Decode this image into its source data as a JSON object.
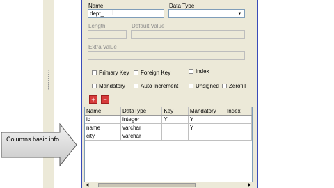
{
  "form": {
    "name_label": "Name",
    "name_value": "dept_",
    "datatype_label": "Data Type",
    "datatype_value": "",
    "length_label": "Length",
    "default_label": "Default Value",
    "extra_label": "Extra Value"
  },
  "options": {
    "primary_key": "Primary Key",
    "foreign_key": "Foreign Key",
    "index": "Index",
    "mandatory": "Mandatory",
    "auto_increment": "Auto Increment",
    "unsigned": "Unsigned",
    "zerofill": "Zerofill"
  },
  "buttons": {
    "add": "+",
    "remove": "−"
  },
  "grid": {
    "headers": [
      "Name",
      "DataType",
      "Key",
      "Mandatory",
      "Index"
    ],
    "rows": [
      [
        "id",
        "integer",
        "Y",
        "Y",
        ""
      ],
      [
        "name",
        "varchar",
        "",
        "Y",
        ""
      ],
      [
        "city",
        "varchar",
        "",
        "",
        ""
      ]
    ]
  },
  "callout": {
    "text": "Columns basic info"
  },
  "colors": {
    "dialog_bg": "#ece9d8",
    "border_blue": "#3a4bb8",
    "callout_fill": "#d9d9d9"
  }
}
